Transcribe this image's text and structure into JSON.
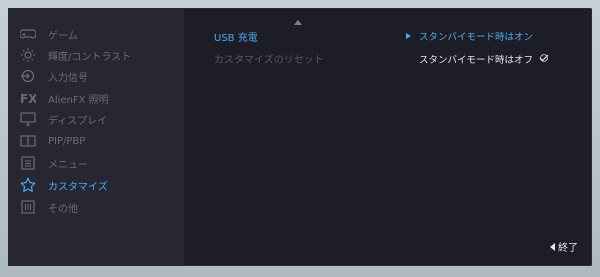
{
  "sidebar": {
    "items": [
      {
        "label": "ゲーム",
        "icon": "gamepad-icon"
      },
      {
        "label": "輝度/コントラスト",
        "icon": "brightness-icon"
      },
      {
        "label": "入力信号",
        "icon": "input-icon"
      },
      {
        "label": "AlienFX 照明",
        "icon": "fx-icon"
      },
      {
        "label": "ディスプレイ",
        "icon": "display-icon"
      },
      {
        "label": "PIP/PBP",
        "icon": "pip-icon"
      },
      {
        "label": "メニュー",
        "icon": "menu-icon"
      },
      {
        "label": "カスタマイズ",
        "icon": "star-icon",
        "active": true
      },
      {
        "label": "その他",
        "icon": "info-icon"
      }
    ]
  },
  "submenu": {
    "items": [
      {
        "label": "USB 充電",
        "active": true
      },
      {
        "label": "カスタマイズのリセット"
      }
    ]
  },
  "options": {
    "items": [
      {
        "label": "スタンバイモード時はオン",
        "selected": true
      },
      {
        "label": "スタンバイモード時はオフ",
        "current": true
      }
    ]
  },
  "footer": {
    "exit_label": "終了"
  },
  "colors": {
    "accent": "#4ea9ef",
    "panel": "#1c1d26",
    "sidebar": "#262732"
  }
}
